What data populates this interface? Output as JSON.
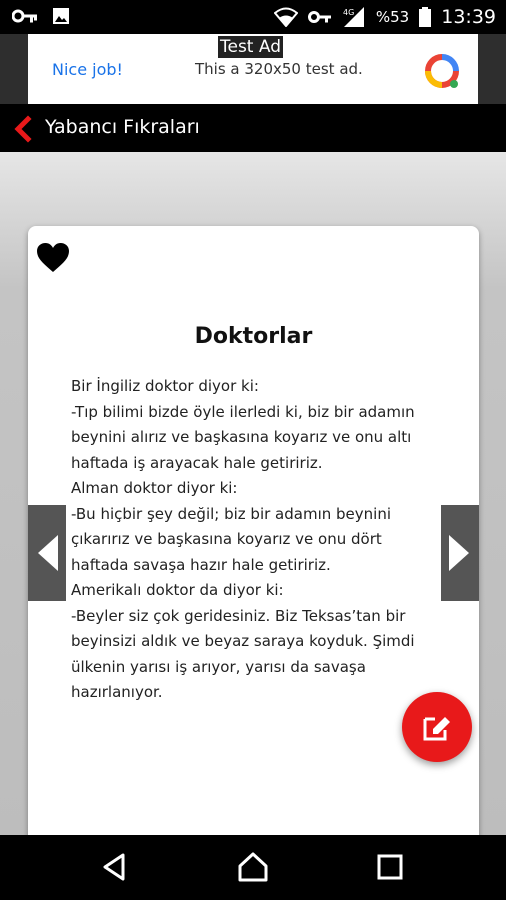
{
  "status_bar": {
    "battery": "%53",
    "time": "13:39",
    "icons": [
      "vpn-key-icon",
      "image-icon",
      "wifi-icon",
      "vpn-key-icon",
      "signal-icon",
      "battery-icon"
    ]
  },
  "ad": {
    "label": "Test Ad",
    "nice_text": "Nice job!",
    "body_text": "This a 320x50 test ad."
  },
  "toolbar": {
    "title": "Yabancı Fıkraları",
    "back_icon": "chevron-left-icon",
    "accent": "#e8191a"
  },
  "joke": {
    "favorite_icon": "heart-icon",
    "title": "Doktorlar",
    "lines": [
      "Bir İngiliz doktor diyor ki:",
      "-Tıp bilimi bizde öyle ilerledi ki, biz bir adamın",
      "beynini alırız ve başkasına koyarız ve onu altı",
      "haftada iş arayacak hale getiririz.",
      "Alman doktor diyor ki:",
      "-Bu hiçbir şey değil; biz bir adamın beynini",
      "çıkarırız ve başkasına koyarız ve onu dört",
      "haftada savaşa hazır hale getiririz.",
      "Amerikalı doktor da diyor ki:",
      "-Beyler siz çok geridesiniz. Biz Teksas’tan bir",
      "beyinsizi aldık ve beyaz saraya koyduk. Şimdi",
      "ülkenin yarısı iş arıyor, yarısı da savaşa",
      "hazırlanıyor."
    ]
  },
  "fab": {
    "icon": "edit-icon",
    "color": "#e8191a"
  },
  "nav": {
    "icons": [
      "back-triangle-icon",
      "home-icon",
      "recents-icon"
    ]
  }
}
